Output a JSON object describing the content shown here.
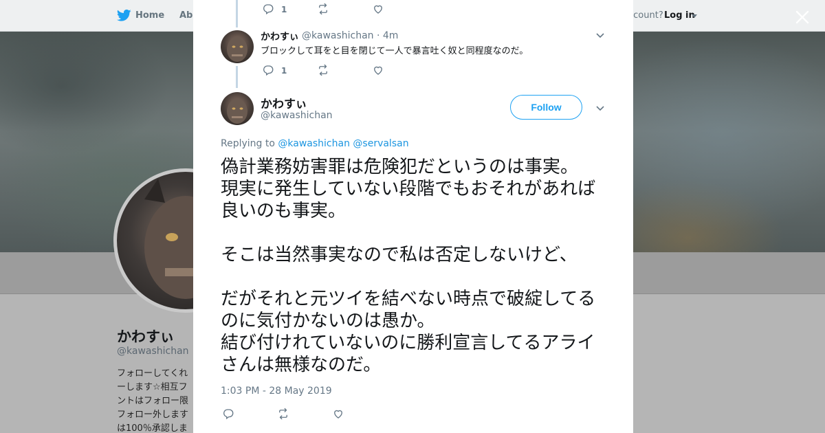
{
  "nav": {
    "home_label": "Home",
    "about_label": "Abo",
    "account_prompt": "ccount?",
    "login_label": "Log in"
  },
  "profile": {
    "name": "かわすぃ",
    "handle": "@kawashichan",
    "bio": "フォローしてくれ\nーします☆相互フ\nントはフォロー限\nフォロー外します\nは100％承認しま"
  },
  "modal": {
    "prev_actions": {
      "reply_count": "1"
    },
    "reply": {
      "name": "かわすぃ",
      "handle": "@kawashichan · 4m",
      "text": "ブロックして耳をと目を閉じて一人で暴言吐く奴と同程度なのだ。",
      "reply_count": "1"
    },
    "main_tweet": {
      "name": "かわすぃ",
      "handle": "@kawashichan",
      "follow_label": "Follow",
      "replying_prefix": "Replying to",
      "replying_to_1": "@kawashichan",
      "replying_to_2": "@servalsan",
      "paragraphs": [
        "偽計業務妨害罪は危険犯だというのは事実。",
        "現実に発生していない段階でもおそれがあれば良いのも事実。",
        "そこは当然事実なので私は否定しないけど、",
        "だがそれと元ツイを結べない時点で破綻してるのに気付かないのは愚か。",
        "結び付けれていないのに勝利宣言してるアライさんは無様なのだ。"
      ],
      "timestamp": "1:03 PM - 28 May 2019"
    }
  },
  "icons": {
    "logo": "twitter-bird-icon",
    "close": "close-icon",
    "reply": "reply-icon",
    "retweet": "retweet-icon",
    "like": "heart-icon",
    "more": "chevron-down-icon"
  },
  "colors": {
    "accent": "#1da1f2",
    "link": "#1b95e0",
    "secondary_text": "#657786",
    "thread_line": "#c4d6e4"
  }
}
